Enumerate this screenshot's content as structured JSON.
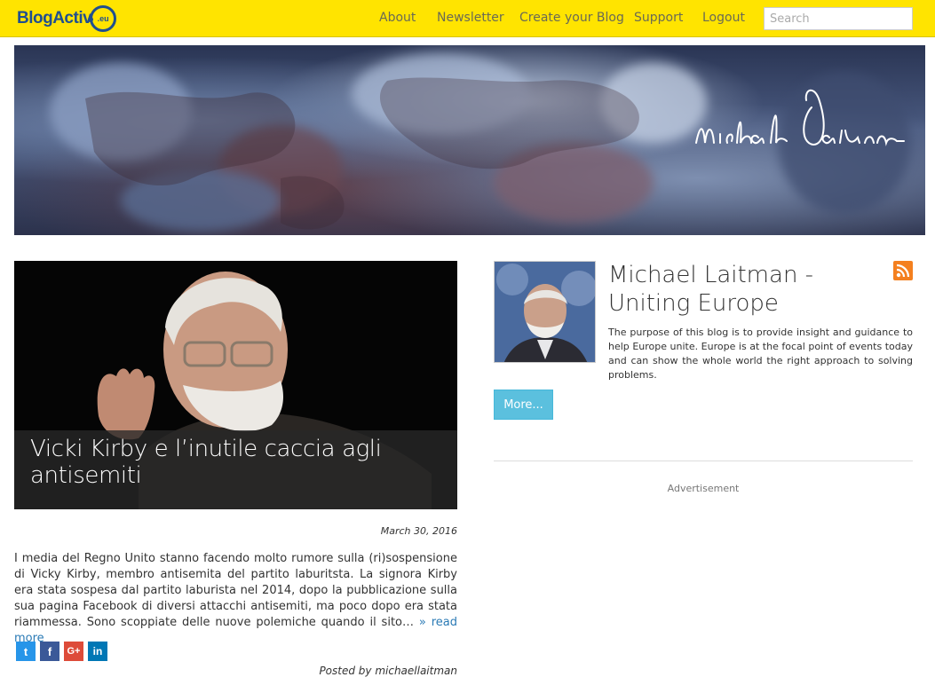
{
  "header": {
    "logo_text": "BlogActiv",
    "logo_suffix": ".eu",
    "nav": [
      {
        "label": "About"
      },
      {
        "label": "Newsletter"
      },
      {
        "label": "Create your Blog"
      },
      {
        "label": "Support"
      },
      {
        "label": "Logout"
      }
    ],
    "search_placeholder": "Search"
  },
  "banner": {
    "signature": "Michael Laitman"
  },
  "article": {
    "title": "Vicki Kirby e l’inutile caccia agli antisemiti",
    "date": "March 30, 2016",
    "excerpt": "I media del Regno Unito stanno facendo molto rumore sulla (ri)sospensione di Vicky Kirby, membro antisemita del partito laburitsta. La signora Kirby era stata sospesa dal partito laburista nel 2014, dopo la pubblicazione sulla sua pagina Facebook di diversi attacchi antisemiti, ma poco dopo era stata riammessa. Sono scoppiate delle nuove polemiche quando il sito…",
    "read_more": " » read more",
    "share": [
      {
        "name": "twitter-icon",
        "glyph": "t",
        "color": "#2795e9"
      },
      {
        "name": "facebook-icon",
        "glyph": "f",
        "color": "#3b5998"
      },
      {
        "name": "google-plus-icon",
        "glyph": "G+",
        "color": "#dd4b39"
      },
      {
        "name": "linkedin-icon",
        "glyph": "in",
        "color": "#0077b5"
      }
    ],
    "posted_by": "Posted by michaellaitman"
  },
  "sidebar": {
    "blog_title": "Michael Laitman - Uniting Europe",
    "description": "The purpose of this blog is to provide insight and guidance to help Europe unite. Europe is at the focal point of events today and can show the whole world the right approach to solving problems.",
    "more_label": "More...",
    "advert_label": "Advertisement"
  }
}
